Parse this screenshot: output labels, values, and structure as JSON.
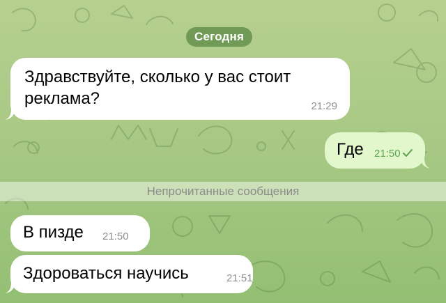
{
  "chat": {
    "date_label": "Сегодня",
    "unread_label": "Непрочитанные сообщения",
    "colors": {
      "incoming_bubble": "#ffffff",
      "outgoing_bubble": "#e2f7cb",
      "date_pill": "#5f8c46",
      "time_muted": "#8e8e93",
      "time_outgoing": "#5aa24e"
    },
    "messages": [
      {
        "direction": "incoming",
        "text_line1": "Здравствуйте, сколько у вас стоит",
        "text_line2": "реклама?",
        "time": "21:29"
      },
      {
        "direction": "outgoing",
        "text": "Где",
        "time": "21:50",
        "status_icon": "check-icon"
      },
      {
        "direction": "incoming",
        "text": "В пизде",
        "time": "21:50"
      },
      {
        "direction": "incoming",
        "text": "Здороваться научись",
        "time": "21:51"
      }
    ]
  }
}
